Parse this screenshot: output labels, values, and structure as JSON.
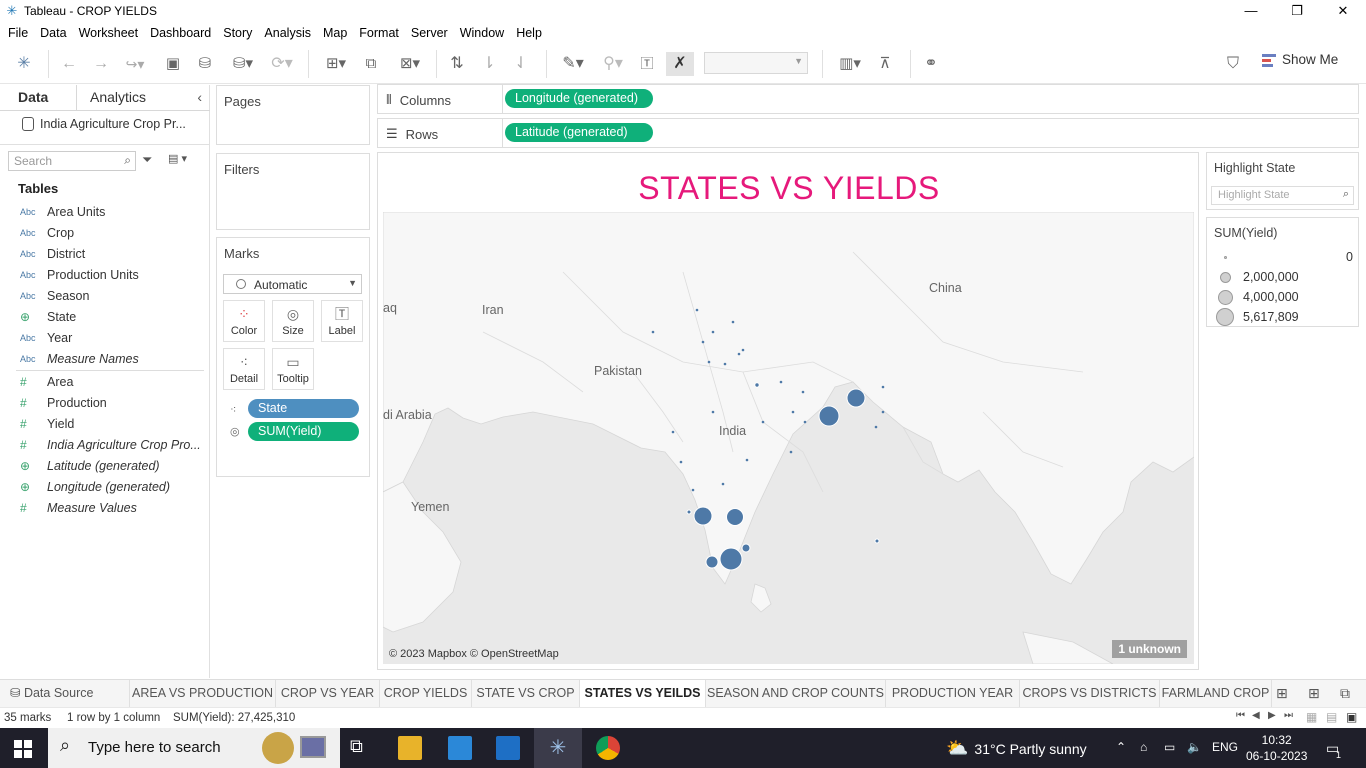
{
  "window": {
    "title": "Tableau - CROP YIELDS",
    "minimize": "—",
    "restore": "❐",
    "close": "✕"
  },
  "menu": [
    "File",
    "Data",
    "Worksheet",
    "Dashboard",
    "Story",
    "Analysis",
    "Map",
    "Format",
    "Server",
    "Window",
    "Help"
  ],
  "toolbar": {
    "show_me": "Show Me"
  },
  "data_pane": {
    "tab_data": "Data",
    "tab_analytics": "Analytics",
    "datasource": "India Agriculture Crop Pr...",
    "search_placeholder": "Search",
    "tables_heading": "Tables",
    "fields": [
      {
        "icon": "Abc",
        "name": "Area Units",
        "italic": false
      },
      {
        "icon": "Abc",
        "name": "Crop",
        "italic": false
      },
      {
        "icon": "Abc",
        "name": "District",
        "italic": false
      },
      {
        "icon": "Abc",
        "name": "Production Units",
        "italic": false
      },
      {
        "icon": "Abc",
        "name": "Season",
        "italic": false
      },
      {
        "icon": "globe",
        "name": "State",
        "italic": false
      },
      {
        "icon": "Abc",
        "name": "Year",
        "italic": false
      },
      {
        "icon": "Abc",
        "name": "Measure Names",
        "italic": true
      },
      {
        "icon": "#",
        "name": "Area",
        "italic": false
      },
      {
        "icon": "#",
        "name": "Production",
        "italic": false
      },
      {
        "icon": "#",
        "name": "Yield",
        "italic": false
      },
      {
        "icon": "#",
        "name": "India Agriculture Crop Pro...",
        "italic": true
      },
      {
        "icon": "globe",
        "name": "Latitude (generated)",
        "italic": true
      },
      {
        "icon": "globe",
        "name": "Longitude (generated)",
        "italic": true
      },
      {
        "icon": "#",
        "name": "Measure Values",
        "italic": true
      }
    ]
  },
  "cards": {
    "pages": "Pages",
    "filters": "Filters",
    "marks": "Marks",
    "mark_type": "Automatic",
    "mark_buttons": [
      "Color",
      "Size",
      "Label",
      "Detail",
      "Tooltip"
    ],
    "mark_pills": [
      "State",
      "SUM(Yield)"
    ]
  },
  "shelves": {
    "columns_label": "Columns",
    "columns_pill": "Longitude (generated)",
    "rows_label": "Rows",
    "rows_pill": "Latitude (generated)"
  },
  "viz": {
    "title": "STATES VS YIELDS",
    "map_labels": [
      "Iran",
      "China",
      "Pakistan",
      "India",
      "Yemen",
      "aq",
      "di Arabia"
    ],
    "attribution": "© 2023 Mapbox © OpenStreetMap",
    "unknown_badge": "1 unknown",
    "colors": {
      "title": "#e6197b",
      "mark": "#4e79a7",
      "map_bg": "#eeeeee",
      "land": "#f7f7f7"
    }
  },
  "legends": {
    "highlight_title": "Highlight State",
    "highlight_placeholder": "Highlight State",
    "size_title": "SUM(Yield)",
    "size_entries": [
      "0",
      "2,000,000",
      "4,000,000",
      "5,617,809"
    ]
  },
  "sheet_tabs": [
    {
      "label": "Data Source",
      "active": false
    },
    {
      "label": "AREA VS PRODUCTION",
      "active": false
    },
    {
      "label": "CROP VS YEAR",
      "active": false
    },
    {
      "label": "CROP YIELDS",
      "active": false
    },
    {
      "label": "STATE VS CROP",
      "active": false
    },
    {
      "label": "STATES VS YEILDS",
      "active": true
    },
    {
      "label": "SEASON AND CROP COUNTS",
      "active": false
    },
    {
      "label": "PRODUCTION YEAR",
      "active": false
    },
    {
      "label": "CROPS VS DISTRICTS",
      "active": false
    },
    {
      "label": "FARMLAND CROP",
      "active": false
    }
  ],
  "status": {
    "marks": "35 marks",
    "dims": "1 row by 1 column",
    "sum": "SUM(Yield): 27,425,310"
  },
  "taskbar": {
    "search_placeholder": "Type here to search",
    "weather": "31°C  Partly sunny",
    "lang": "ENG",
    "time": "10:32",
    "date": "06-10-2023",
    "notif_count": "1"
  }
}
